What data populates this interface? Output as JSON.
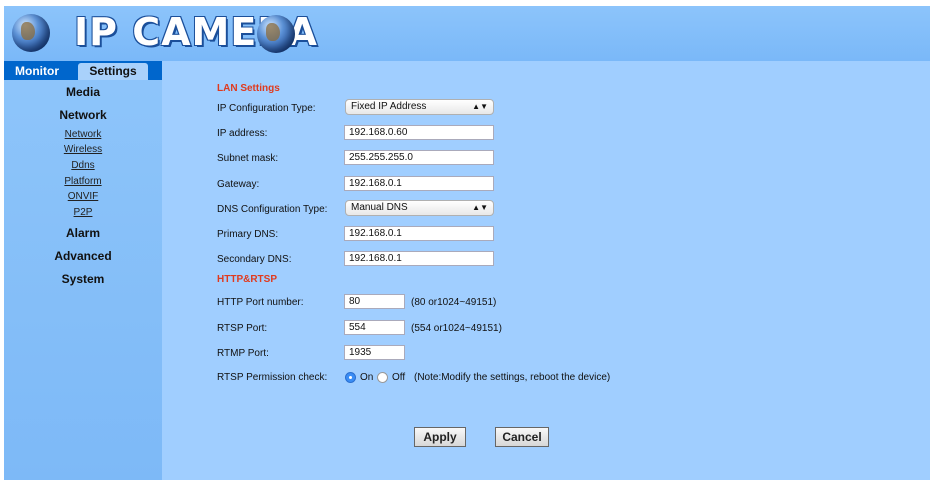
{
  "header": {
    "logo_text": "IP CAMERA"
  },
  "tabs": {
    "monitor": "Monitor",
    "settings": "Settings"
  },
  "menu": {
    "media": "Media",
    "network": "Network",
    "network_items": [
      "Network",
      "Wireless",
      "Ddns",
      "Platform",
      "ONVIF",
      "P2P"
    ],
    "alarm": "Alarm",
    "advanced": "Advanced",
    "system": "System"
  },
  "lan": {
    "section_title": "LAN Settings",
    "ip_config_type_label": "IP Configuration Type:",
    "ip_config_type_value": "Fixed IP Address",
    "ip_address_label": "IP address:",
    "ip_address_value": "192.168.0.60",
    "subnet_label": "Subnet mask:",
    "subnet_value": "255.255.255.0",
    "gateway_label": "Gateway:",
    "gateway_value": "192.168.0.1",
    "dns_config_type_label": "DNS Configuration Type:",
    "dns_config_type_value": "Manual DNS",
    "primary_dns_label": "Primary DNS:",
    "primary_dns_value": "192.168.0.1",
    "secondary_dns_label": "Secondary DNS:",
    "secondary_dns_value": "192.168.0.1"
  },
  "http": {
    "section_title": "HTTP&RTSP",
    "http_port_label": "HTTP Port number:",
    "http_port_value": "80",
    "http_port_hint": "(80 or1024~49151)",
    "rtsp_port_label": "RTSP Port:",
    "rtsp_port_value": "554",
    "rtsp_port_hint": "(554 or1024~49151)",
    "rtmp_port_label": "RTMP Port:",
    "rtmp_port_value": "1935",
    "rtsp_perm_label": "RTSP Permission check:",
    "rtsp_perm_on": "On",
    "rtsp_perm_off": "Off",
    "rtsp_perm_note": "(Note:Modify the settings, reboot the device)",
    "rtsp_perm_selected": "On"
  },
  "buttons": {
    "apply": "Apply",
    "cancel": "Cancel"
  },
  "colors": {
    "section_title": "#e03a1e",
    "header": "#8cc4fb",
    "content": "#a0ceff",
    "tab_bar": "#0066cc"
  }
}
